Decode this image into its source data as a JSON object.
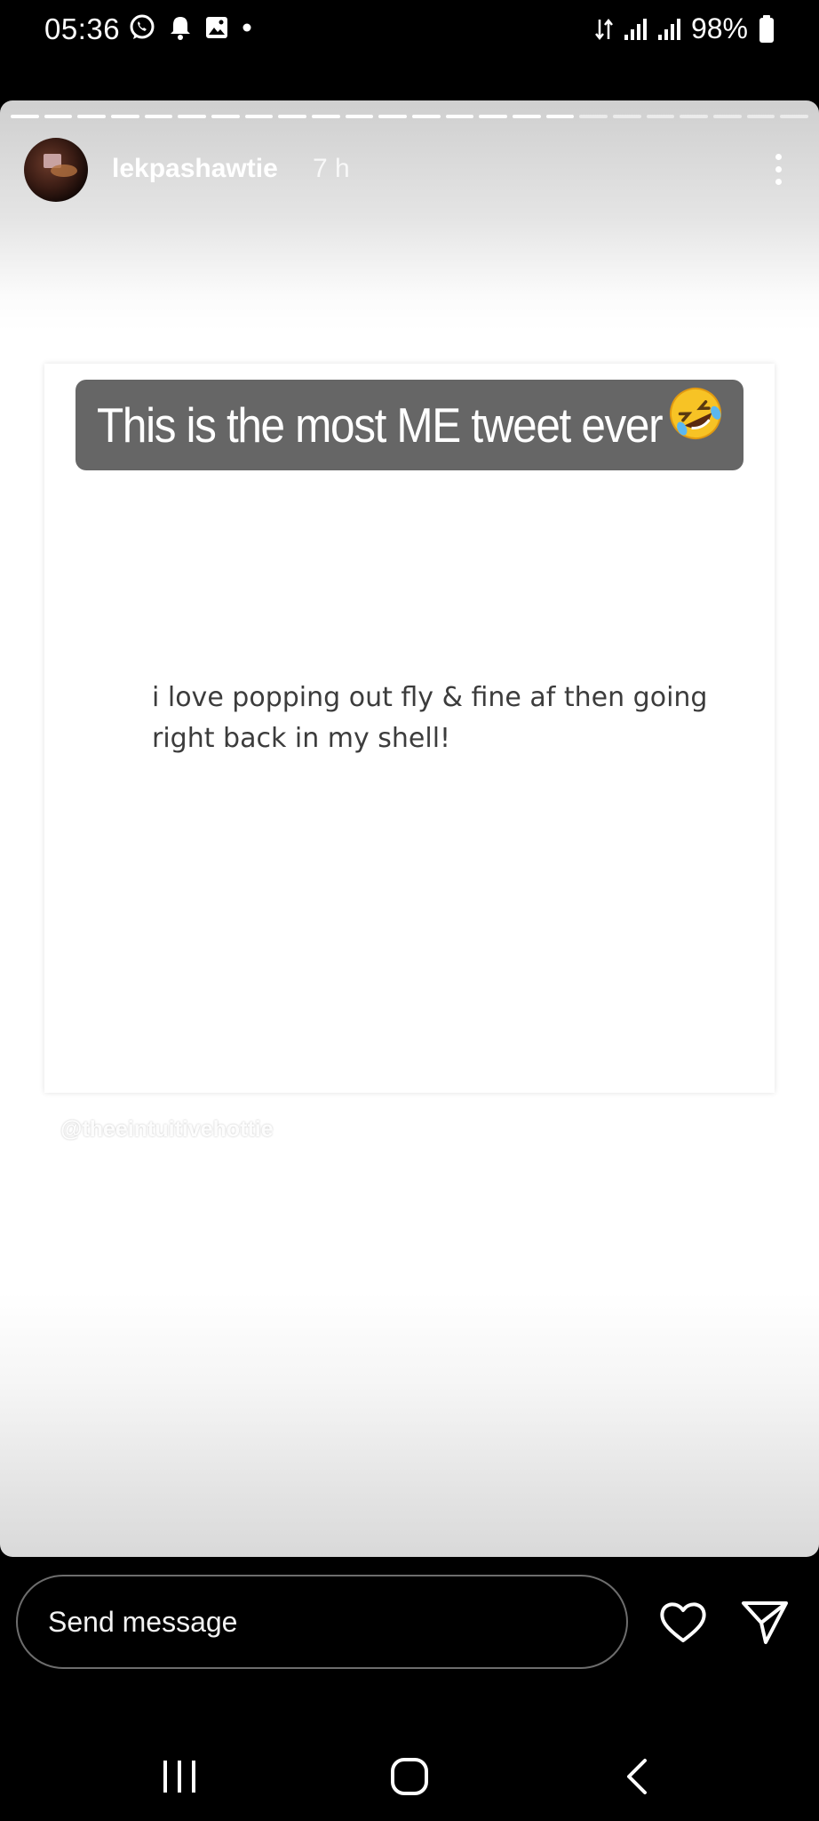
{
  "status_bar": {
    "time": "05:36",
    "battery": "98%",
    "left_icons": [
      "whatsapp-icon",
      "bell-icon",
      "gallery-icon",
      "dot-icon"
    ],
    "right_icons": [
      "data-arrows-icon",
      "signal-icon",
      "signal-icon",
      "battery-icon"
    ]
  },
  "story": {
    "progress": {
      "segments_total": 24,
      "segments_viewed": 17
    },
    "username": "lekpashawtie",
    "time_ago": "7 h",
    "caption": "This is the most ME tweet ever",
    "caption_emoji": "rolling-on-floor-laughing-emoji",
    "tweet_text": "i love popping out fly & fine af then going right back in my shell!",
    "credit": "@theeintuitivehottie"
  },
  "reply_bar": {
    "placeholder": "Send message",
    "like_icon": "heart-icon",
    "share_icon": "send-icon"
  },
  "nav_bar": {
    "buttons": [
      "recents-icon",
      "home-icon",
      "back-icon"
    ]
  },
  "colors": {
    "background": "#000000",
    "caption_bg": "#666666",
    "tweet_text": "#3c3c3c"
  }
}
